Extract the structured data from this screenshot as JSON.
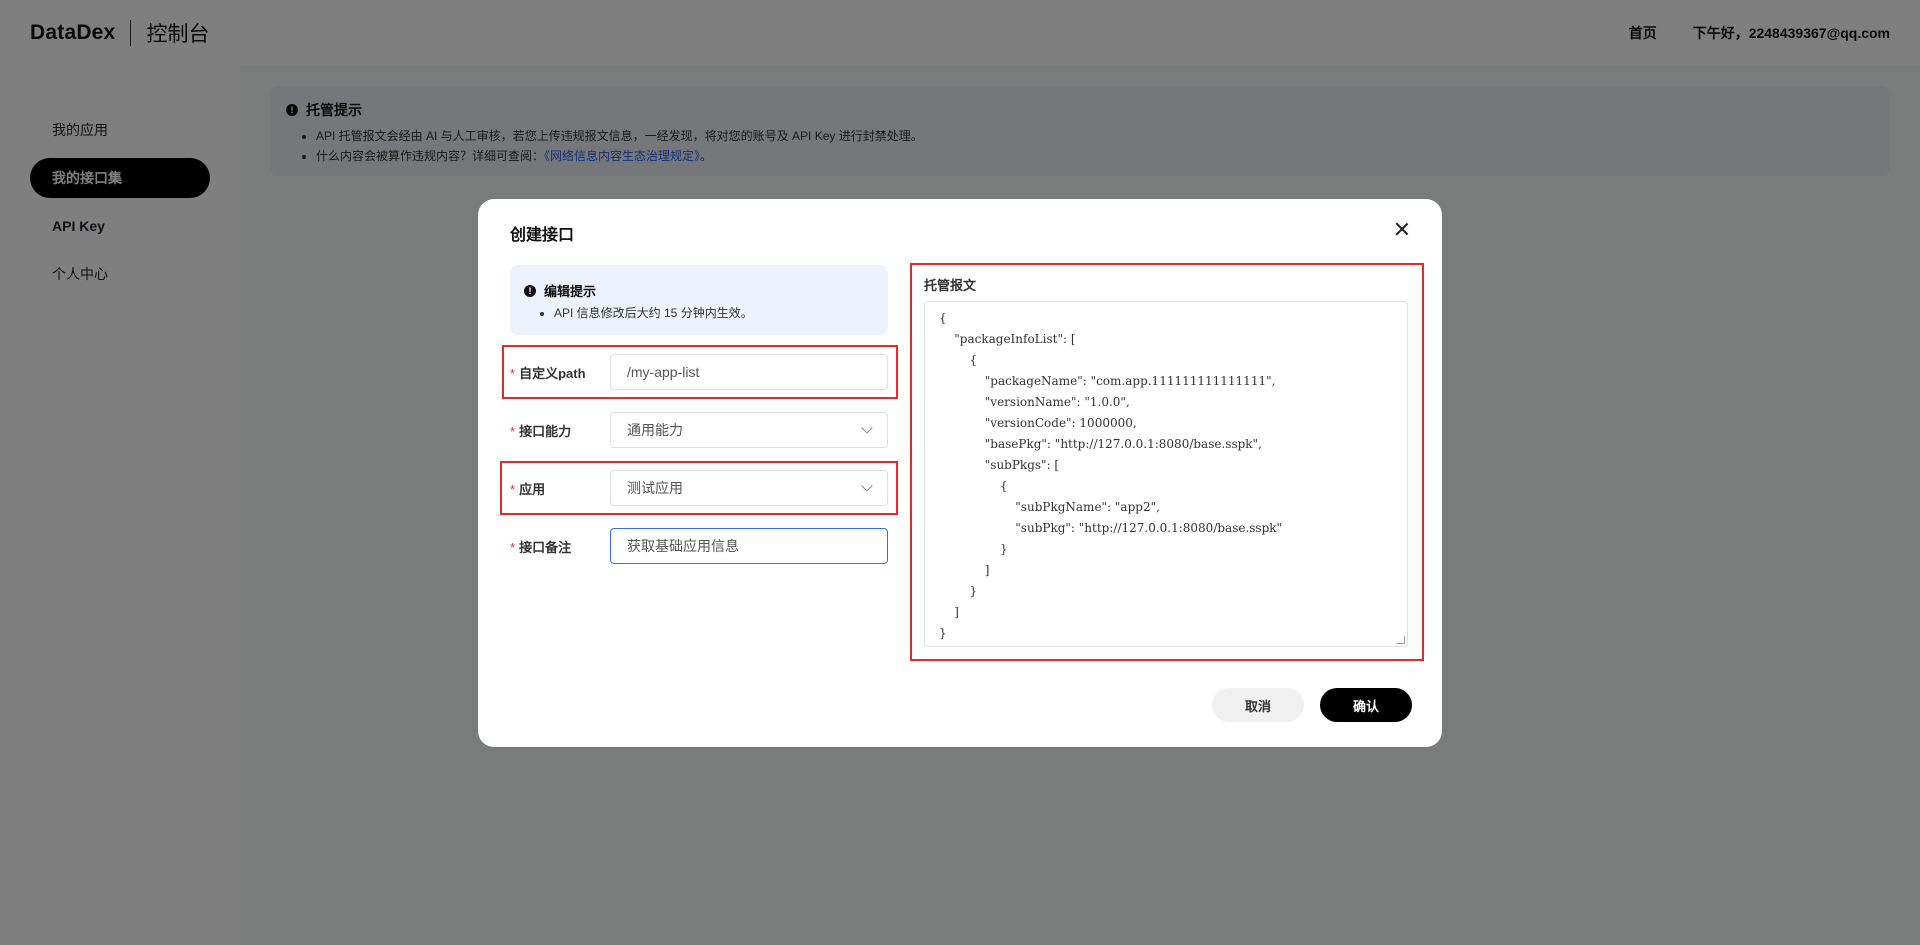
{
  "header": {
    "brand": "DataDex",
    "console": "控制台",
    "home": "首页",
    "greeting": "下午好，2248439367@qq.com"
  },
  "sidebar": {
    "items": [
      {
        "label": "我的应用"
      },
      {
        "label": "我的接口集",
        "active": true
      },
      {
        "label": "API Key"
      },
      {
        "label": "个人中心"
      }
    ]
  },
  "notice": {
    "title": "托管提示",
    "line1": "API 托管报文会经由 AI 与人工审核，若您上传违规报文信息，一经发现，将对您的账号及 API Key 进行封禁处理。",
    "line2_prefix": "什么内容会被算作违规内容？详细可查阅：",
    "line2_link": "《网络信息内容生态治理规定》",
    "line2_suffix": "。"
  },
  "modal": {
    "title": "创建接口",
    "tip": {
      "title": "编辑提示",
      "text": "API 信息修改后大约 15 分钟内生效。"
    },
    "fields": {
      "path": {
        "label": "自定义path",
        "value": "/my-app-list"
      },
      "capability": {
        "label": "接口能力",
        "value": "通用能力"
      },
      "app": {
        "label": "应用",
        "value": "测试应用"
      },
      "remark": {
        "label": "接口备注",
        "value": "获取基础应用信息"
      }
    },
    "required_mark": "*",
    "payload_label": "托管报文",
    "payload": "{\n    \"packageInfoList\": [\n        {\n            \"packageName\": \"com.app.111111111111111\",\n            \"versionName\": \"1.0.0\",\n            \"versionCode\": 1000000,\n            \"basePkg\": \"http://127.0.0.1:8080/base.sspk\",\n            \"subPkgs\": [\n                {\n                    \"subPkgName\": \"app2\",\n                    \"subPkg\": \"http://127.0.0.1:8080/base.sspk\"\n                }\n            ]\n        }\n    ]\n}",
    "cancel": "取消",
    "confirm": "确认"
  },
  "colors": {
    "highlight": "#e42a2a",
    "primary_button": "#000000",
    "link": "#2b5ff0"
  }
}
